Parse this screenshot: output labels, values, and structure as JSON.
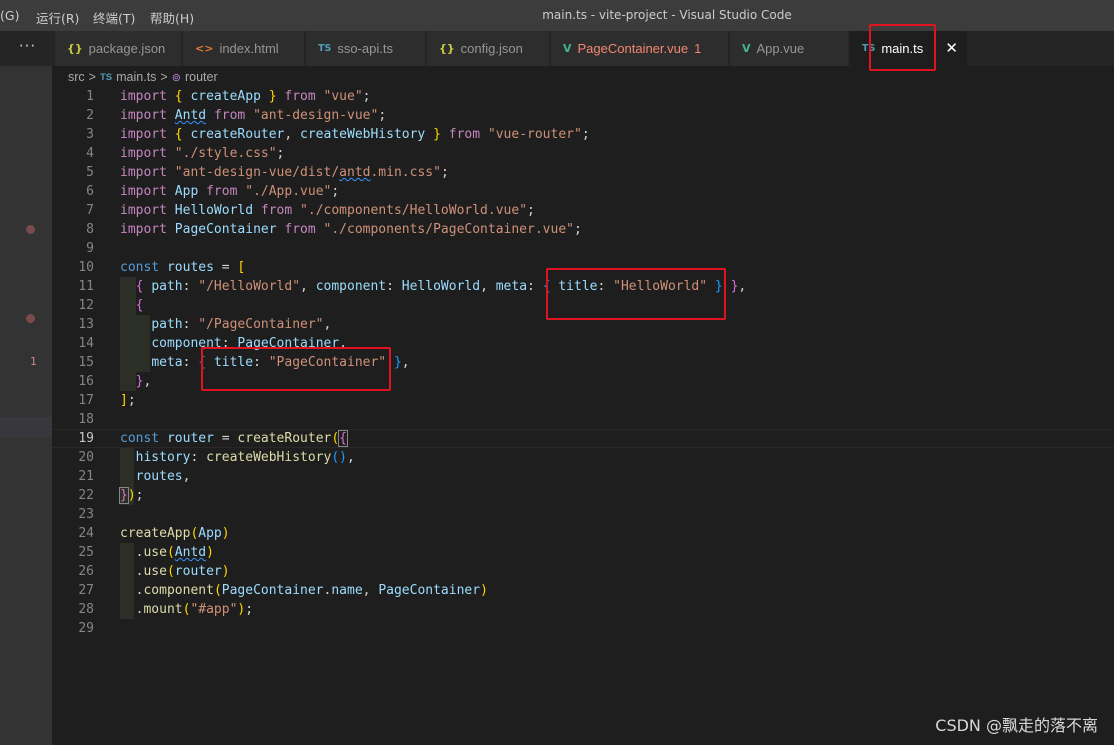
{
  "menu": {
    "items": [
      "(G)",
      "运行(R)",
      "终端(T)",
      "帮助(H)"
    ]
  },
  "window_title": "main.ts - vite-project - Visual Studio Code",
  "tabs": [
    {
      "icon": "{}",
      "icon_name": "json-file-icon",
      "label": "package.json",
      "badge": ""
    },
    {
      "icon": "<>",
      "icon_name": "html-file-icon",
      "label": "index.html",
      "badge": ""
    },
    {
      "icon": "TS",
      "icon_name": "typescript-file-icon",
      "label": "sso-api.ts",
      "badge": ""
    },
    {
      "icon": "{}",
      "icon_name": "json-file-icon",
      "label": "config.json",
      "badge": ""
    },
    {
      "icon": "V",
      "icon_name": "vue-file-icon",
      "label": "PageContainer.vue",
      "badge": "1"
    },
    {
      "icon": "V",
      "icon_name": "vue-file-icon",
      "label": "App.vue",
      "badge": ""
    },
    {
      "icon": "TS",
      "icon_name": "typescript-file-icon",
      "label": "main.ts",
      "badge": ""
    }
  ],
  "tab_more": "···",
  "close_glyph": "✕",
  "breadcrumb": {
    "folder": "src",
    "sep": ">",
    "file_icon": "TS",
    "file": "main.ts",
    "symbol_icon": "⊚",
    "symbol": "router"
  },
  "gutter": {
    "error_count": "1"
  },
  "line_numbers": [
    "1",
    "2",
    "3",
    "4",
    "5",
    "6",
    "7",
    "8",
    "9",
    "10",
    "11",
    "12",
    "13",
    "14",
    "15",
    "16",
    "17",
    "18",
    "19",
    "20",
    "21",
    "22",
    "23",
    "24",
    "25",
    "26",
    "27",
    "28",
    "29"
  ],
  "current_line": "19",
  "watermark": "CSDN @飘走的落不离",
  "colors": {
    "accent_red_box": "#e0141e",
    "keyword": "#c586c0",
    "string": "#ce9178",
    "variable": "#9cdcfe",
    "function": "#dcdcaa"
  }
}
